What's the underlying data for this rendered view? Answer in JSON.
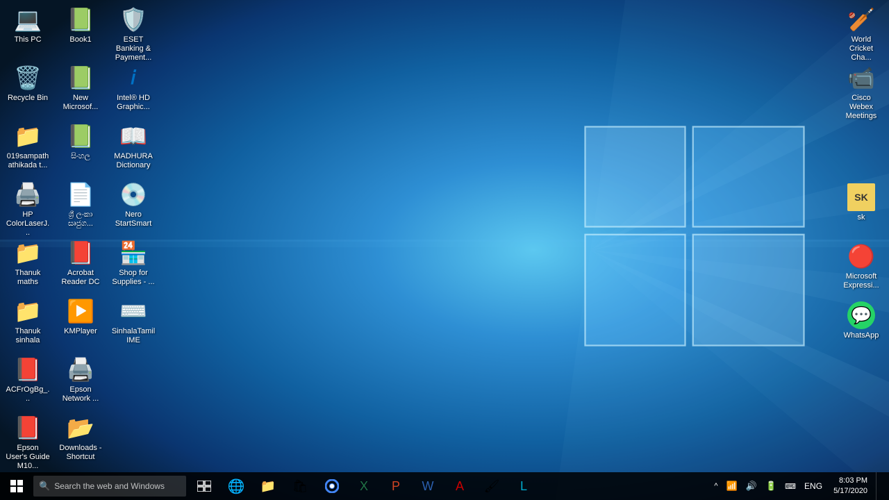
{
  "desktop": {
    "background": "windows10-blue",
    "icons_left": [
      {
        "id": "this-pc",
        "label": "This PC",
        "row": 0,
        "col": 0,
        "type": "computer"
      },
      {
        "id": "book1",
        "label": "Book1",
        "row": 0,
        "col": 1,
        "type": "excel"
      },
      {
        "id": "eset-banking",
        "label": "ESET Banking & Payment...",
        "row": 0,
        "col": 2,
        "type": "eset"
      },
      {
        "id": "recycle-bin",
        "label": "Recycle Bin",
        "row": 1,
        "col": 0,
        "type": "recycle"
      },
      {
        "id": "new-microsoft",
        "label": "New Microsof...",
        "row": 1,
        "col": 1,
        "type": "excel"
      },
      {
        "id": "intel-hd",
        "label": "Intel® HD Graphic...",
        "row": 1,
        "col": 2,
        "type": "intel"
      },
      {
        "id": "019sampath",
        "label": "019sampath athikada t...",
        "row": 2,
        "col": 0,
        "type": "folder"
      },
      {
        "id": "sinhala2",
        "label": "සිංහල",
        "row": 2,
        "col": 1,
        "type": "excel"
      },
      {
        "id": "madhura",
        "label": "MADHURA Dictionary",
        "row": 2,
        "col": 2,
        "type": "madhura"
      },
      {
        "id": "hp-color",
        "label": "HP ColorLaserJ...",
        "row": 3,
        "col": 0,
        "type": "printer"
      },
      {
        "id": "sinhala-doc",
        "label": "ශ්‍රී ලංකා සෘජුග...",
        "row": 3,
        "col": 1,
        "type": "word"
      },
      {
        "id": "nero",
        "label": "Nero StartSmart",
        "row": 3,
        "col": 2,
        "type": "nero"
      },
      {
        "id": "thanuk-maths",
        "label": "Thanuk maths",
        "row": 4,
        "col": 0,
        "type": "folder"
      },
      {
        "id": "acrobat",
        "label": "Acrobat Reader DC",
        "row": 4,
        "col": 1,
        "type": "pdf"
      },
      {
        "id": "shop-supplies",
        "label": "Shop for Supplies - ...",
        "row": 4,
        "col": 2,
        "type": "shop"
      },
      {
        "id": "thanuk-sinhala",
        "label": "Thanuk sinhala",
        "row": 5,
        "col": 0,
        "type": "folder"
      },
      {
        "id": "kmplayer",
        "label": "KMPlayer",
        "row": 5,
        "col": 1,
        "type": "kmplayer"
      },
      {
        "id": "sinhala-tamil-ime",
        "label": "SinhalaTamil IME",
        "row": 5,
        "col": 2,
        "type": "ime"
      },
      {
        "id": "acfrogbg",
        "label": "ACFrOgBg_...",
        "row": 6,
        "col": 0,
        "type": "pdf"
      },
      {
        "id": "epson-network",
        "label": "Epson Network ...",
        "row": 6,
        "col": 1,
        "type": "epson"
      },
      {
        "id": "epson-guide",
        "label": "Epson User's Guide M10...",
        "row": 7,
        "col": 0,
        "type": "pdf"
      },
      {
        "id": "downloads-shortcut",
        "label": "Downloads - Shortcut",
        "row": 7,
        "col": 1,
        "type": "folder-shortcut"
      }
    ],
    "icons_right": [
      {
        "id": "world-cricket",
        "label": "World Cricket Cha...",
        "type": "game"
      },
      {
        "id": "cisco-webex",
        "label": "Cisco Webex Meetings",
        "type": "webex"
      },
      {
        "id": "sk",
        "label": "sk",
        "type": "folder"
      },
      {
        "id": "microsoft-express",
        "label": "Microsoft Expressi...",
        "type": "ms"
      },
      {
        "id": "whatsapp",
        "label": "WhatsApp",
        "type": "whatsapp"
      }
    ]
  },
  "taskbar": {
    "search_placeholder": "Search the web and Windows",
    "apps": [
      {
        "id": "task-view",
        "label": "Task View",
        "icon": "⧉"
      },
      {
        "id": "edge",
        "label": "Microsoft Edge",
        "icon": "🌐"
      },
      {
        "id": "explorer",
        "label": "File Explorer",
        "icon": "📁"
      },
      {
        "id": "store",
        "label": "Microsoft Store",
        "icon": "🛍"
      },
      {
        "id": "chrome",
        "label": "Google Chrome",
        "icon": "🔵"
      },
      {
        "id": "excel-tb",
        "label": "Excel",
        "icon": "📊"
      },
      {
        "id": "powerpoint-tb",
        "label": "PowerPoint",
        "icon": "📑"
      },
      {
        "id": "word-tb",
        "label": "Word",
        "icon": "📝"
      },
      {
        "id": "acrobat-tb",
        "label": "Acrobat",
        "icon": "🔴"
      },
      {
        "id": "paint-tb",
        "label": "Paint",
        "icon": "🖌"
      },
      {
        "id": "unknown-tb",
        "label": "App",
        "icon": "⚙"
      }
    ],
    "tray": {
      "chevron": "^",
      "network": "📶",
      "volume": "🔊",
      "battery": "🔋",
      "keyboard": "⌨",
      "lang": "ENG",
      "time": "8:03 PM",
      "date": "5/17/2020"
    }
  }
}
